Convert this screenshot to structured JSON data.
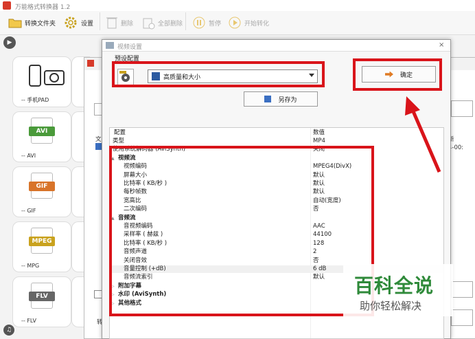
{
  "app": {
    "title": "万能格式转换器 1.2"
  },
  "toolbar": {
    "convert_folder": "转换文件夹",
    "settings": "设置",
    "delete": "删除",
    "delete_all": "全部删除",
    "pause": "暂停",
    "start": "开始转化"
  },
  "cards": [
    {
      "label": "-- 手机PAD",
      "icon": "phone-camera-icon"
    },
    {
      "label": "-- AVI",
      "band": "AVI",
      "color": "#4a9a3a"
    },
    {
      "label": "-- GIF",
      "band": "GIF",
      "color": "#d8742a"
    },
    {
      "label": "-- MPG",
      "band": "MPEG",
      "color": "#c9a21e"
    },
    {
      "label": "-- FLV",
      "band": "FLV",
      "color": "#666666"
    }
  ],
  "bg_dialog": {
    "col_wen": "文",
    "col_xin": "新",
    "cell_right": "4-00:",
    "bottom_zhuan": "转"
  },
  "dialog": {
    "title": "视频设置",
    "close": "×",
    "preset_label": "预设配置",
    "preset_value": "高质量和大小",
    "ok_label": "确定",
    "saveas_label": "另存为"
  },
  "table": {
    "col_config": "配置",
    "col_value": "数值",
    "rows": [
      {
        "k": "类型",
        "v": "MP4",
        "indent": 0
      },
      {
        "k": "使用系统解码器 (AviSynth)",
        "v": "关闭",
        "indent": 0
      },
      {
        "k": "视频流",
        "v": "",
        "indent": 1,
        "group": true,
        "open": true
      },
      {
        "k": "视频编码",
        "v": "MPEG4(DivX)",
        "indent": 2
      },
      {
        "k": "屏幕大小",
        "v": "默认",
        "indent": 2
      },
      {
        "k": "比特率 ( KB/秒 )",
        "v": "默认",
        "indent": 2
      },
      {
        "k": "每秒帧数",
        "v": "默认",
        "indent": 2
      },
      {
        "k": "宽高比",
        "v": "自动(宽度)",
        "indent": 2
      },
      {
        "k": "二次编码",
        "v": "否",
        "indent": 2
      },
      {
        "k": "音频流",
        "v": "",
        "indent": 1,
        "group": true,
        "open": true
      },
      {
        "k": "音视频编码",
        "v": "AAC",
        "indent": 2
      },
      {
        "k": "采样率 ( 赫兹 )",
        "v": "44100",
        "indent": 2
      },
      {
        "k": "比特率 ( KB/秒 )",
        "v": "128",
        "indent": 2
      },
      {
        "k": "音频声道",
        "v": "2",
        "indent": 2
      },
      {
        "k": "关闭音效",
        "v": "否",
        "indent": 2
      },
      {
        "k": "音量控制 (+dB)",
        "v": "6 dB",
        "indent": 2,
        "hl": true
      },
      {
        "k": "音频流索引",
        "v": "默认",
        "indent": 2
      },
      {
        "k": "附加字幕",
        "v": "",
        "indent": 1,
        "group": true,
        "open": false
      },
      {
        "k": "水印 (AviSynth)",
        "v": "",
        "indent": 1,
        "group": true,
        "open": false
      },
      {
        "k": "其他格式",
        "v": "",
        "indent": 1,
        "group": true,
        "open": false
      }
    ]
  },
  "watermark": {
    "main": "百科全说",
    "sub": "助你轻松解决"
  },
  "colors": {
    "red_annotation": "#d9141a",
    "watermark_green": "#2f8a3a"
  }
}
